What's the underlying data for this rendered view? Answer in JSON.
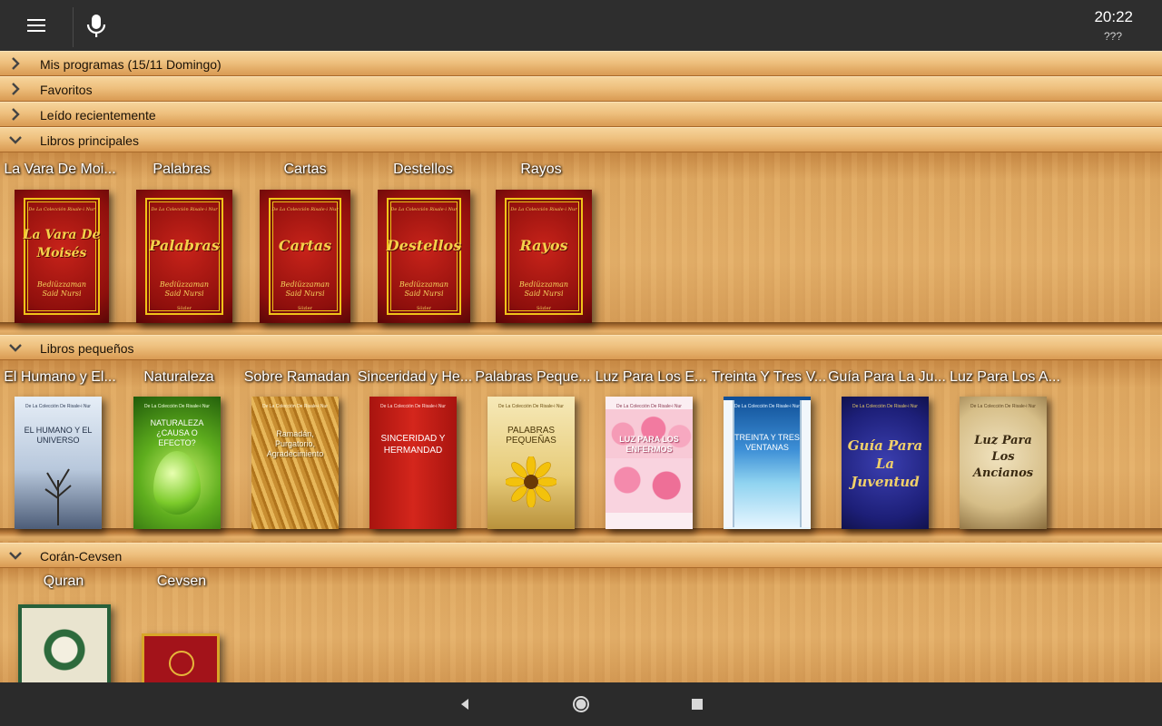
{
  "topbar": {
    "time": "20:22",
    "subtext": "???",
    "icons": {
      "menu": "menu-icon",
      "mic": "microphone-icon"
    }
  },
  "sections": {
    "mis_programas": "Mis programas  (15/11 Domingo)",
    "favoritos": "Favoritos",
    "leido": "Leído recientemente",
    "principales": "Libros principales",
    "pequenos": "Libros pequeños",
    "coran": "Corán-Cevsen"
  },
  "principales_books": [
    {
      "title": "La Vara De Moi...",
      "cover_header": "De La Colección Risale-i Nur",
      "cover_title": "La Vara De Moisés",
      "author_line1": "Bediüzzaman",
      "author_line2": "Said Nursi",
      "publisher": ""
    },
    {
      "title": "Palabras",
      "cover_header": "De La Colección Risale-i Nur",
      "cover_title": "Palabras",
      "author_line1": "Bediüzzaman",
      "author_line2": "Said Nursi",
      "publisher": "Sözler"
    },
    {
      "title": "Cartas",
      "cover_header": "De La Colección Risale-i Nur",
      "cover_title": "Cartas",
      "author_line1": "Bediüzzaman",
      "author_line2": "Said Nursi",
      "publisher": "Sözler"
    },
    {
      "title": "Destellos",
      "cover_header": "De La Colección Risale-i Nur",
      "cover_title": "Destellos",
      "author_line1": "Bediüzzaman",
      "author_line2": "Said Nursi",
      "publisher": "Sözler"
    },
    {
      "title": "Rayos",
      "cover_header": "De La Colección Risale-i Nur",
      "cover_title": "Rayos",
      "author_line1": "Bediüzzaman",
      "author_line2": "Said Nursi",
      "publisher": "Sözler"
    }
  ],
  "pequenos_books": [
    {
      "title": "El Humano y El...",
      "cover_title": "EL HUMANO Y EL UNIVERSO"
    },
    {
      "title": "Naturaleza",
      "cover_title": "NATURALEZA ¿CAUSA O EFECTO?"
    },
    {
      "title": "Sobre Ramadan",
      "cover_title": "Ramadán, Purgatorio, Agradecimiento"
    },
    {
      "title": "Sinceridad y He...",
      "cover_title": "SINCERIDAD Y HERMANDAD"
    },
    {
      "title": "Palabras Peque...",
      "cover_title": "PALABRAS PEQUEÑAS"
    },
    {
      "title": "Luz Para Los E...",
      "cover_title": "LUZ PARA LOS ENFERMOS"
    },
    {
      "title": "Treinta Y Tres V...",
      "cover_title": "TREINTA Y TRES VENTANAS"
    },
    {
      "title": "Guía Para La Ju...",
      "cover_title": "Guía Para La Juventud"
    },
    {
      "title": "Luz Para Los A...",
      "cover_title": "Luz Para Los Ancianos"
    }
  ],
  "pequenos_header": "De La Colección De Risale-i Nur",
  "coran_books": [
    {
      "title": "Quran"
    },
    {
      "title": "Cevsen"
    }
  ],
  "navbar": {
    "back": "back-icon",
    "home": "home-icon",
    "recents": "recents-icon"
  },
  "colors": {
    "topbar": "#2e2e2e",
    "cover_red": "#a8150f",
    "cover_gold": "#f0c419",
    "wood": "#e5b16b"
  }
}
